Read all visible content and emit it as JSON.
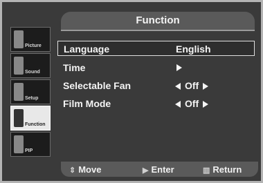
{
  "menu": {
    "title": "Function",
    "items": [
      {
        "label": "Language",
        "value": "English"
      },
      {
        "label": "Time",
        "value": ""
      },
      {
        "label": "Selectable Fan",
        "value": "Off"
      },
      {
        "label": "Film Mode",
        "value": "Off"
      }
    ]
  },
  "sidebar": {
    "items": [
      {
        "label": "Picture"
      },
      {
        "label": "Sound"
      },
      {
        "label": "Setup"
      },
      {
        "label": "Function"
      },
      {
        "label": "PIP"
      }
    ]
  },
  "footer": {
    "move": "Move",
    "enter": "Enter",
    "return": "Return",
    "move_icon": "updown-icon",
    "enter_icon": "enter-icon",
    "return_icon": "return-icon"
  },
  "colors": {
    "background": "#3a3a3a",
    "highlight_border": "#e0e0e0",
    "text": "#f5f5f5"
  }
}
